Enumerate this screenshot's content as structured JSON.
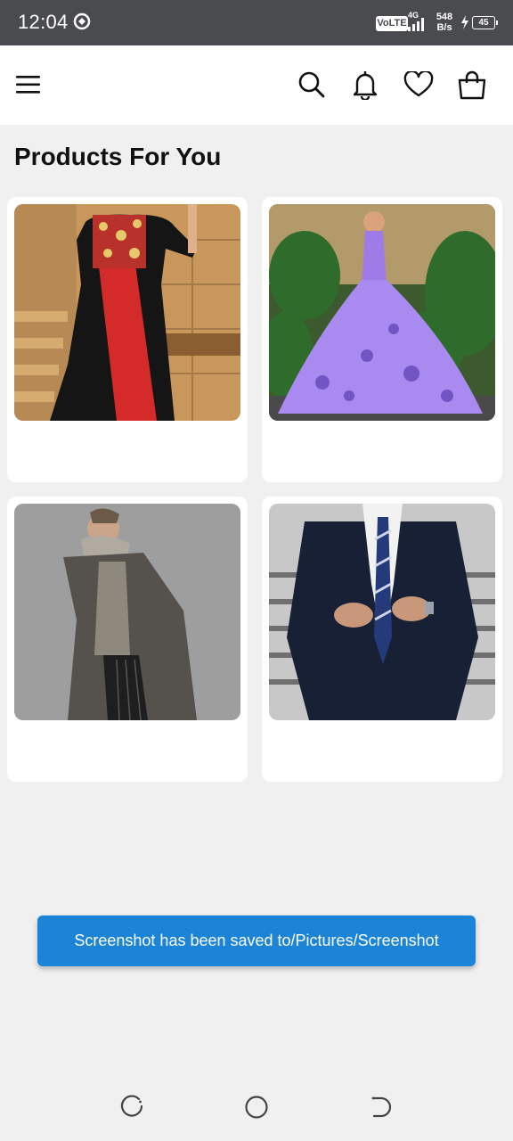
{
  "status_bar": {
    "time": "12:04",
    "volte": "VoLTE",
    "network_type": "4G",
    "net_speed_value": "548",
    "net_speed_unit": "B/s",
    "battery": "45"
  },
  "app_bar": {
    "icons": [
      "menu-icon",
      "search-icon",
      "bell-icon",
      "heart-icon",
      "shopping-bag-icon"
    ]
  },
  "main": {
    "section_title": "Products For You",
    "products": [
      {
        "image": "black and red embroidered long gown"
      },
      {
        "image": "lavender floral ball gown"
      },
      {
        "image": "grey overcoat with hoodie"
      },
      {
        "image": "navy suit with striped tie"
      }
    ]
  },
  "toast": {
    "message": "Screenshot has been saved to/Pictures/Screenshot"
  },
  "nav_bar": {
    "icons": [
      "recents-icon",
      "home-icon",
      "back-icon"
    ]
  },
  "colors": {
    "status_bar": "#4a4b4e",
    "background": "#f0f0f0",
    "toast": "#1b84d6"
  }
}
